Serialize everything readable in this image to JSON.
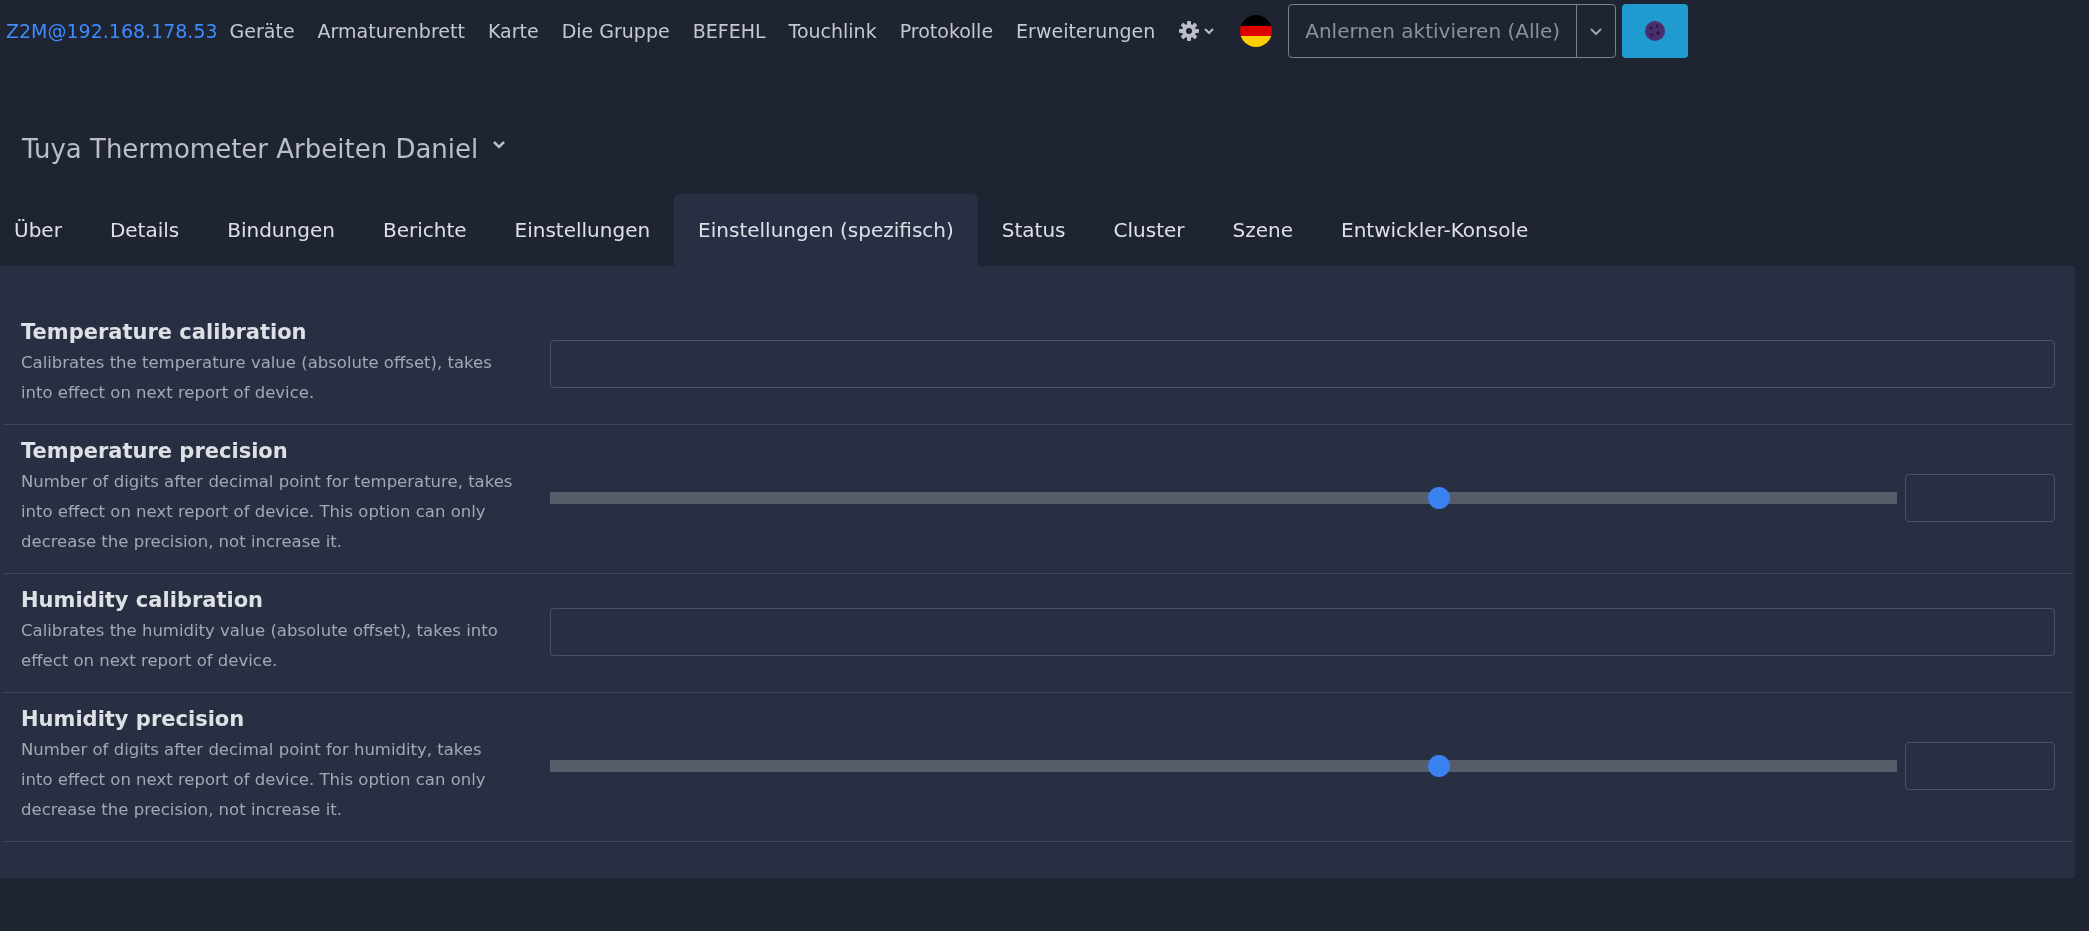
{
  "nav": {
    "brand": "Z2M@192.168.178.53",
    "items": [
      "Geräte",
      "Armaturenbrett",
      "Karte",
      "Die Gruppe",
      "BEFEHL",
      "Touchlink",
      "Protokolle",
      "Erweiterungen"
    ],
    "permit_join": {
      "label": "Anlernen aktivieren (Alle)"
    }
  },
  "device": {
    "title": "Tuya Thermometer Arbeiten Daniel"
  },
  "tabs": [
    {
      "label": "Über",
      "selected": false
    },
    {
      "label": "Details",
      "selected": false
    },
    {
      "label": "Bindungen",
      "selected": false
    },
    {
      "label": "Berichte",
      "selected": false
    },
    {
      "label": "Einstellungen",
      "selected": false
    },
    {
      "label": "Einstellungen (spezifisch)",
      "selected": true
    },
    {
      "label": "Status",
      "selected": false
    },
    {
      "label": "Cluster",
      "selected": false
    },
    {
      "label": "Szene",
      "selected": false
    },
    {
      "label": "Entwickler-Konsole",
      "selected": false
    }
  ],
  "settings": [
    {
      "kind": "input",
      "title": "Temperature calibration",
      "description": "Calibrates the temperature value (absolute offset), takes into effect on next report of device."
    },
    {
      "kind": "slider",
      "title": "Temperature precision",
      "description": "Number of digits after decimal point for temperature, takes into effect on next report of device. This option can only decrease the precision, not increase it.",
      "level": 0.66
    },
    {
      "kind": "input",
      "title": "Humidity calibration",
      "description": "Calibrates the humidity value (absolute offset), takes into effect on next report of device."
    },
    {
      "kind": "slider",
      "title": "Humidity precision",
      "description": "Number of digits after decimal point for humidity, takes into effect on next report of device. This option can only decrease the precision, not increase it.",
      "level": 0.66
    }
  ]
}
